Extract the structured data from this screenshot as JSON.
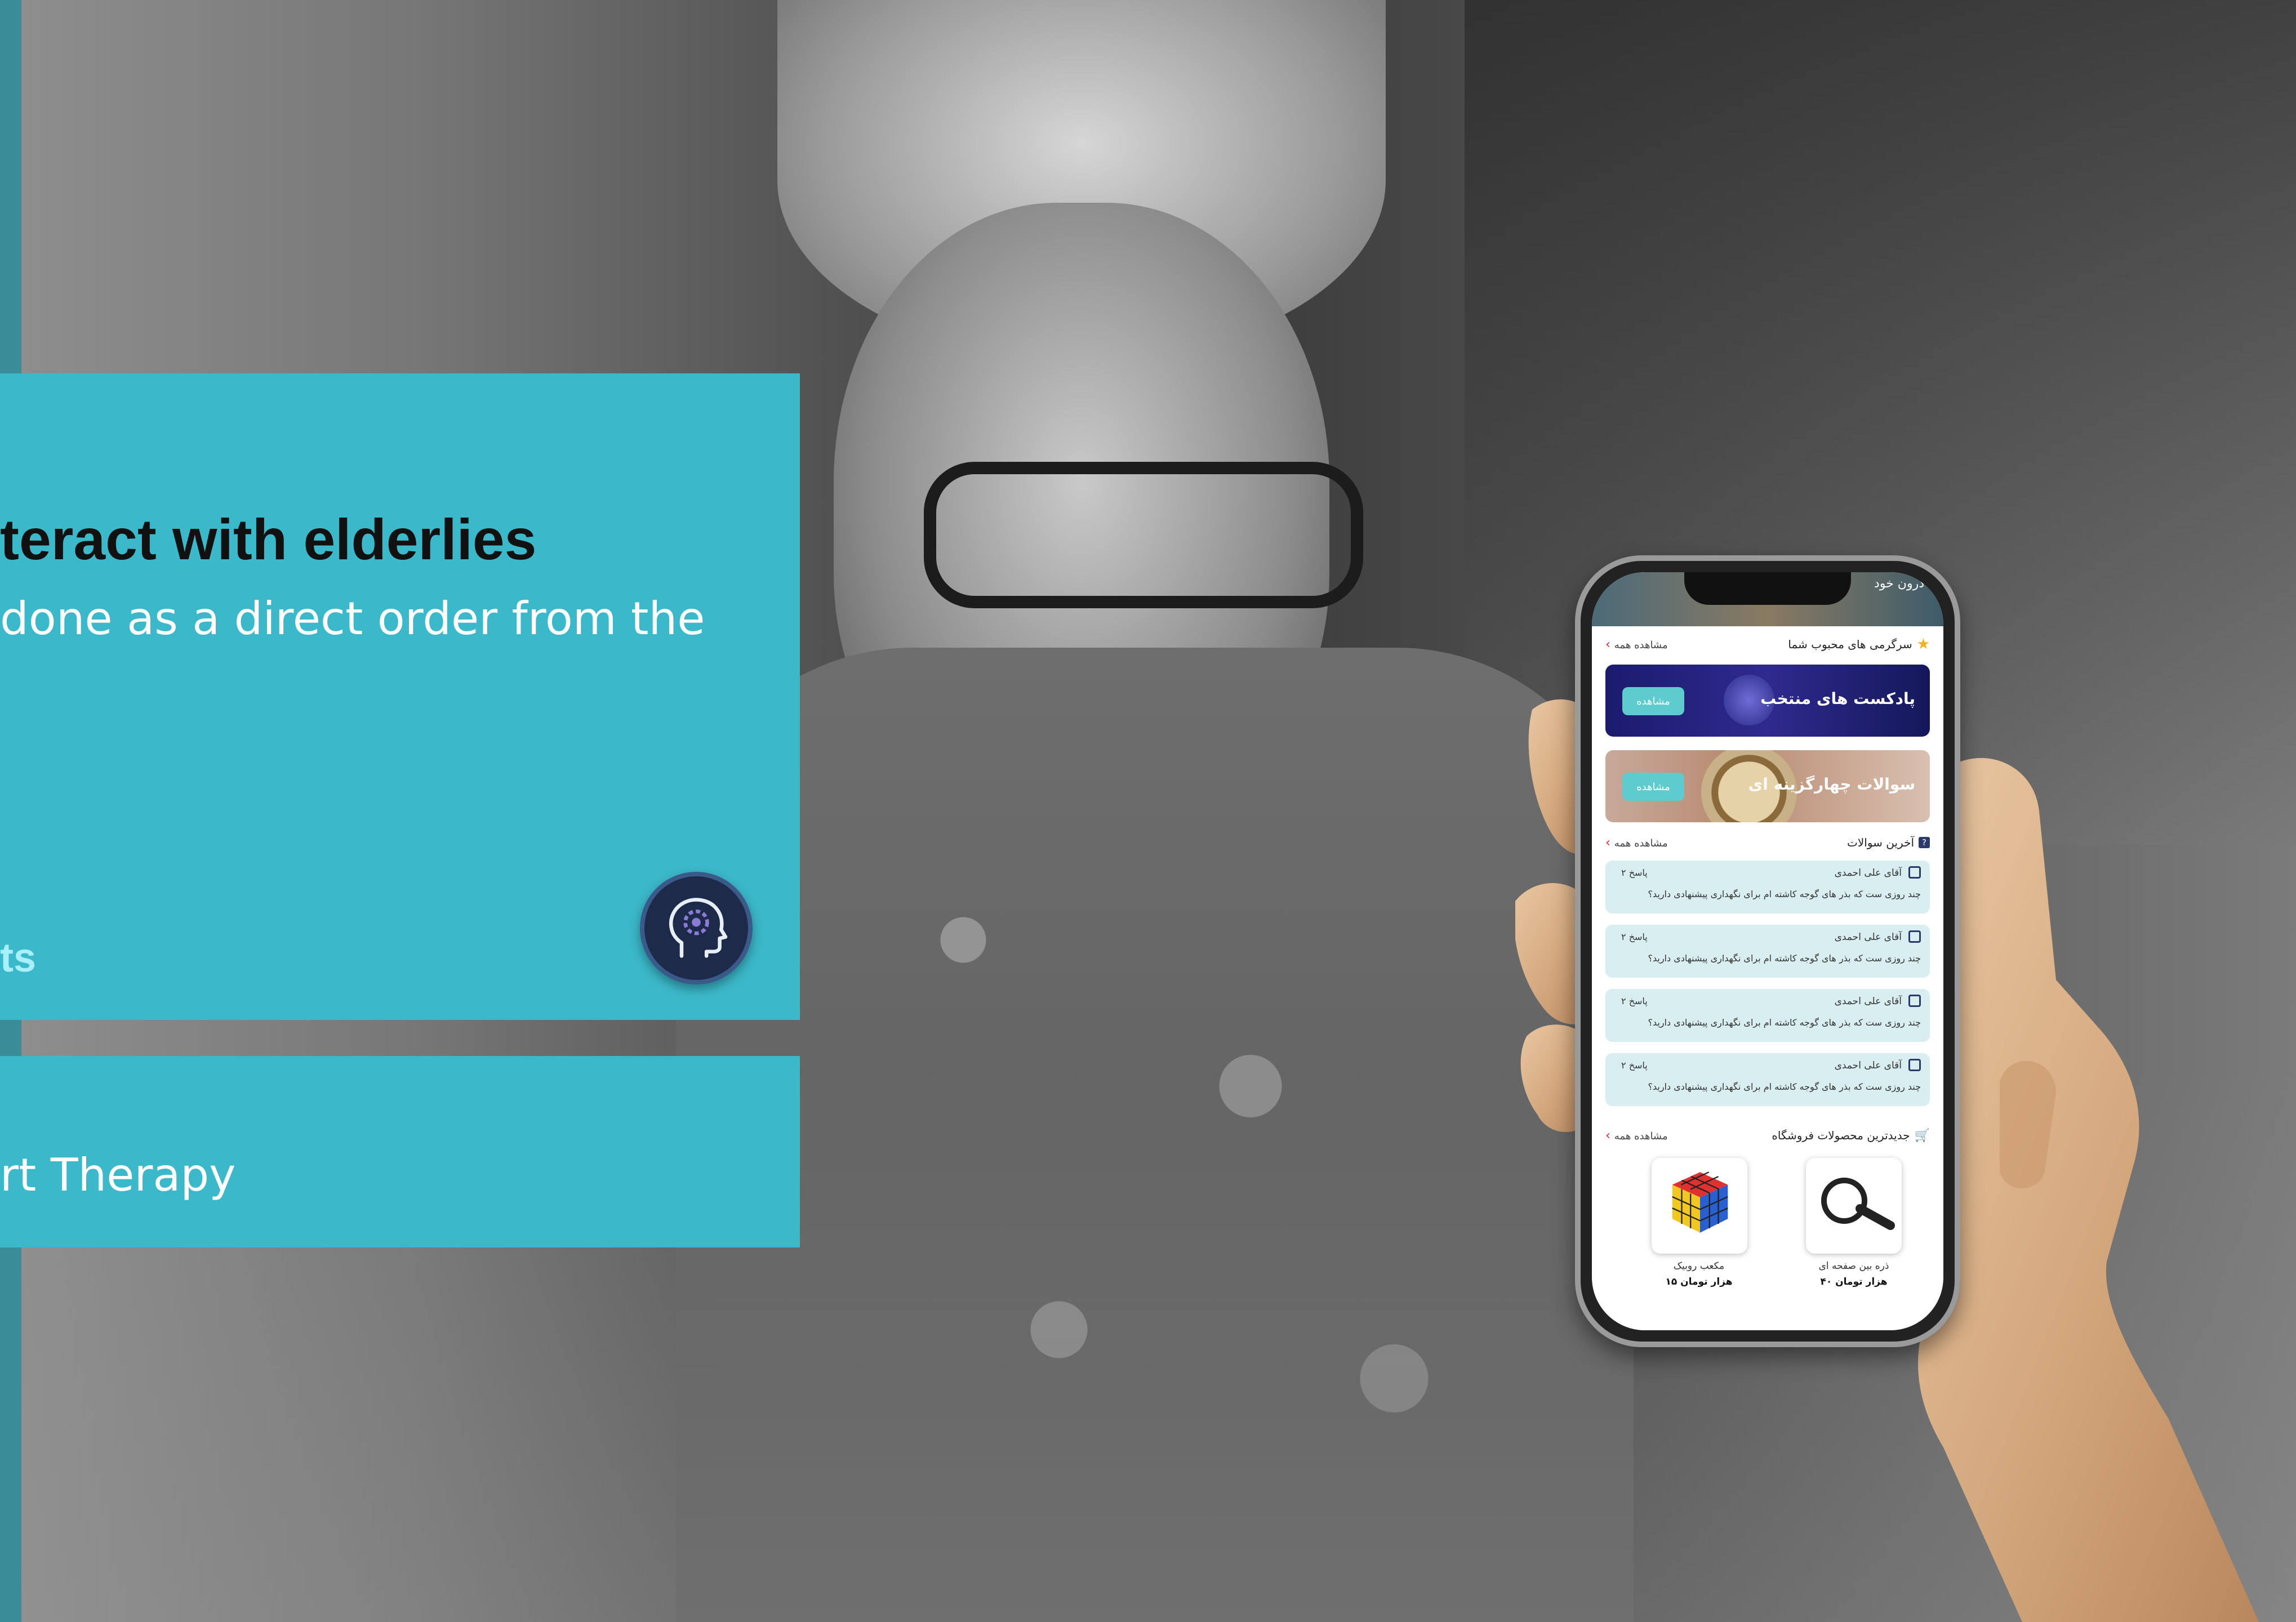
{
  "slide": {
    "headline": "teract with elderlies",
    "subtext": "done as a direct order from the",
    "link_text": "ts",
    "category": "rt Therapy"
  },
  "icons": {
    "badge": "head-gear-icon",
    "star": "star-icon",
    "question": "question-icon",
    "cart": "cart-icon",
    "user": "user-icon",
    "chevron": "chevron-left-icon"
  },
  "colors": {
    "panel": "#3bb8c9",
    "link": "#a8f0ff",
    "badge_bg": "#1d2a4a",
    "button": "#5ecbcf"
  },
  "phone": {
    "top_banner_text": "درون خود",
    "favorites": {
      "title": "سرگرمی های محبوب شما",
      "see_all": "مشاهده همه"
    },
    "banners": [
      {
        "title": "پادکست های منتخب",
        "button": "مشاهده"
      },
      {
        "title": "سوالات چهارگزینه ای",
        "button": "مشاهده"
      }
    ],
    "questions": {
      "title": "آخرین سوالات",
      "see_all": "مشاهده همه",
      "items": [
        {
          "user": "آقای علی احمدی",
          "answers": "۲ پاسخ",
          "text": "چند روزی ست که بذر های گوجه کاشته ام برای نگهداری پیشنهادی دارید؟"
        },
        {
          "user": "آقای علی احمدی",
          "answers": "۲ پاسخ",
          "text": "چند روزی ست که بذر های گوجه کاشته ام برای نگهداری پیشنهادی دارید؟"
        },
        {
          "user": "آقای علی احمدی",
          "answers": "۲ پاسخ",
          "text": "چند روزی ست که بذر های گوجه کاشته ام برای نگهداری پیشنهادی دارید؟"
        },
        {
          "user": "آقای علی احمدی",
          "answers": "۲ پاسخ",
          "text": "چند روزی ست که بذر های گوجه کاشته ام برای نگهداری پیشنهادی دارید؟"
        }
      ]
    },
    "shop": {
      "title": "جدیدترین محصولات فروشگاه",
      "see_all": "مشاهده همه",
      "products": [
        {
          "name": "ذره بین صفحه ای",
          "price": "۴۰ هزار تومان"
        },
        {
          "name": "مکعب روبیک",
          "price": "۱۵ هزار تومان"
        }
      ]
    }
  }
}
